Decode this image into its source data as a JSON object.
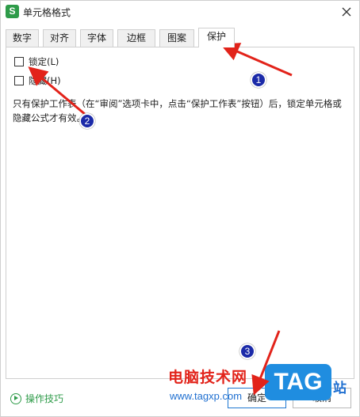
{
  "window": {
    "app_icon": "S",
    "title": "单元格格式"
  },
  "tabs": [
    {
      "label": "数字",
      "active": false
    },
    {
      "label": "对齐",
      "active": false
    },
    {
      "label": "字体",
      "active": false
    },
    {
      "label": "边框",
      "active": false
    },
    {
      "label": "图案",
      "active": false
    },
    {
      "label": "保护",
      "active": true
    }
  ],
  "protection": {
    "lock_label": "锁定(L)",
    "lock_checked": false,
    "hide_label": "隐藏(H)",
    "hide_checked": false,
    "note": "只有保护工作表（在“审阅”选项卡中，点击“保护工作表”按钮）后，锁定单元格或隐藏公式才有效。"
  },
  "footer": {
    "tips_label": "操作技巧",
    "ok_label": "确定",
    "cancel_label": "取消"
  },
  "annotations": {
    "badges": [
      "1",
      "2",
      "3"
    ],
    "arrow_color": "#e2231a",
    "badge_color": "#1b2aa8"
  },
  "watermark": {
    "text": "电脑技术网",
    "url": "www.tagxp.com",
    "logo": "TAG",
    "site": "站"
  },
  "icons": {
    "close": "close-icon",
    "tips": "play-circle-icon"
  }
}
